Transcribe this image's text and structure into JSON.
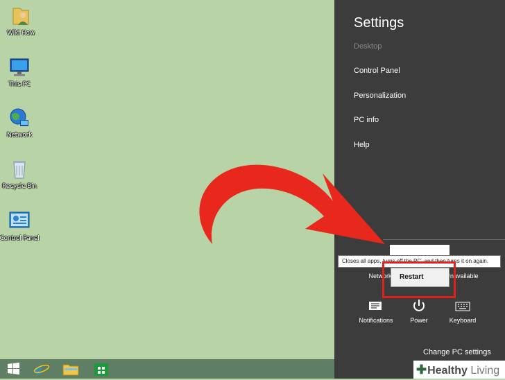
{
  "desktop": {
    "icons": [
      {
        "label": "Wiki How",
        "icon": "user-folder-icon"
      },
      {
        "label": "This PC",
        "icon": "computer-icon"
      },
      {
        "label": "Network",
        "icon": "network-globe-icon"
      },
      {
        "label": "Recycle Bin",
        "icon": "recycle-bin-icon"
      },
      {
        "label": "Control Panel",
        "icon": "control-panel-icon"
      }
    ]
  },
  "taskbar": {
    "buttons": [
      "windows-start-icon",
      "internet-explorer-icon",
      "file-explorer-icon",
      "store-icon"
    ]
  },
  "charms": {
    "title": "Settings",
    "items": [
      "Desktop",
      "Control Panel",
      "Personalization",
      "PC info",
      "Help"
    ],
    "tooltip": "Closes all apps, turns off the PC, and then turns it on again.",
    "tiles_top": {
      "network_label": "Network",
      "unavailable_label": "Unavailable"
    },
    "tiles_bottom": [
      {
        "label": "Notifications",
        "icon": "notifications-icon"
      },
      {
        "label": "Power",
        "icon": "power-icon"
      },
      {
        "label": "Keyboard",
        "icon": "keyboard-icon"
      }
    ],
    "restart_label": "Restart",
    "change_pc_settings": "Change PC settings"
  },
  "watermark": {
    "brand_bold": "Healthy",
    "brand_light": "Living"
  },
  "colors": {
    "desktop": "#b8d4a6",
    "charms_bg": "#3c3c3c",
    "arrow_red": "#e8281c",
    "highlight_red": "#e0201a",
    "taskbar": "#5f7f64"
  }
}
